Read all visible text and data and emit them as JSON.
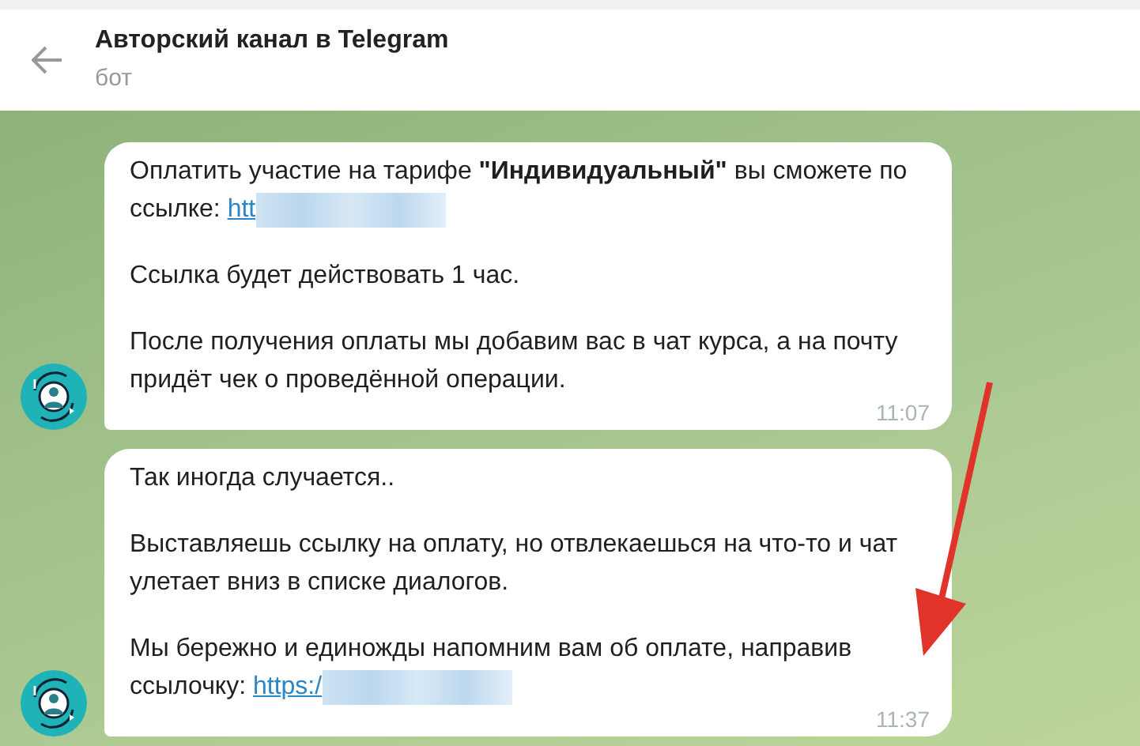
{
  "header": {
    "title": "Авторский канал в Telegram",
    "subtitle": "бот"
  },
  "messages": [
    {
      "paragraphs": [
        {
          "text": "Оплатить участие на тарифе **\"Индивидуальный\"** вы сможете по ссылке:",
          "link": "htt"
        },
        {
          "text": "Ссылка будет действовать 1 час."
        },
        {
          "text": "После получения оплаты мы добавим вас в чат курса, а на почту придёт чек о проведённой операции."
        }
      ],
      "time": "11:07"
    },
    {
      "paragraphs": [
        {
          "text": "Так иногда случается.."
        },
        {
          "text": "Выставляешь ссылку на оплату, но отвлекаешься на что-то и чат улетает вниз в списке диалогов."
        },
        {
          "text": "Мы бережно и единожды напомним вам об оплате, направив ссылочку:",
          "link": "https:/"
        }
      ],
      "time": "11:37"
    }
  ]
}
